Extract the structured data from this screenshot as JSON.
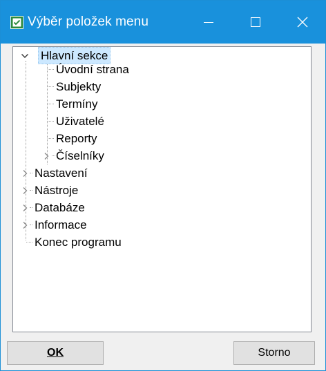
{
  "window": {
    "title": "Výběr položek menu",
    "icon": "checkbox-list-icon",
    "accent_color": "#1991dc"
  },
  "tree": {
    "root": {
      "label": "Hlavní sekce",
      "expanded": true,
      "selected": true,
      "children": [
        "Úvodní strana",
        "Subjekty",
        "Termíny",
        "Uživatelé",
        "Reporty"
      ],
      "collapsed_child": "Číselníky"
    },
    "collapsed_items": [
      "Nastavení",
      "Nástroje",
      "Databáze",
      "Informace"
    ],
    "leaf_item": "Konec programu"
  },
  "buttons": {
    "ok_label": "OK",
    "cancel_label": "Storno"
  }
}
